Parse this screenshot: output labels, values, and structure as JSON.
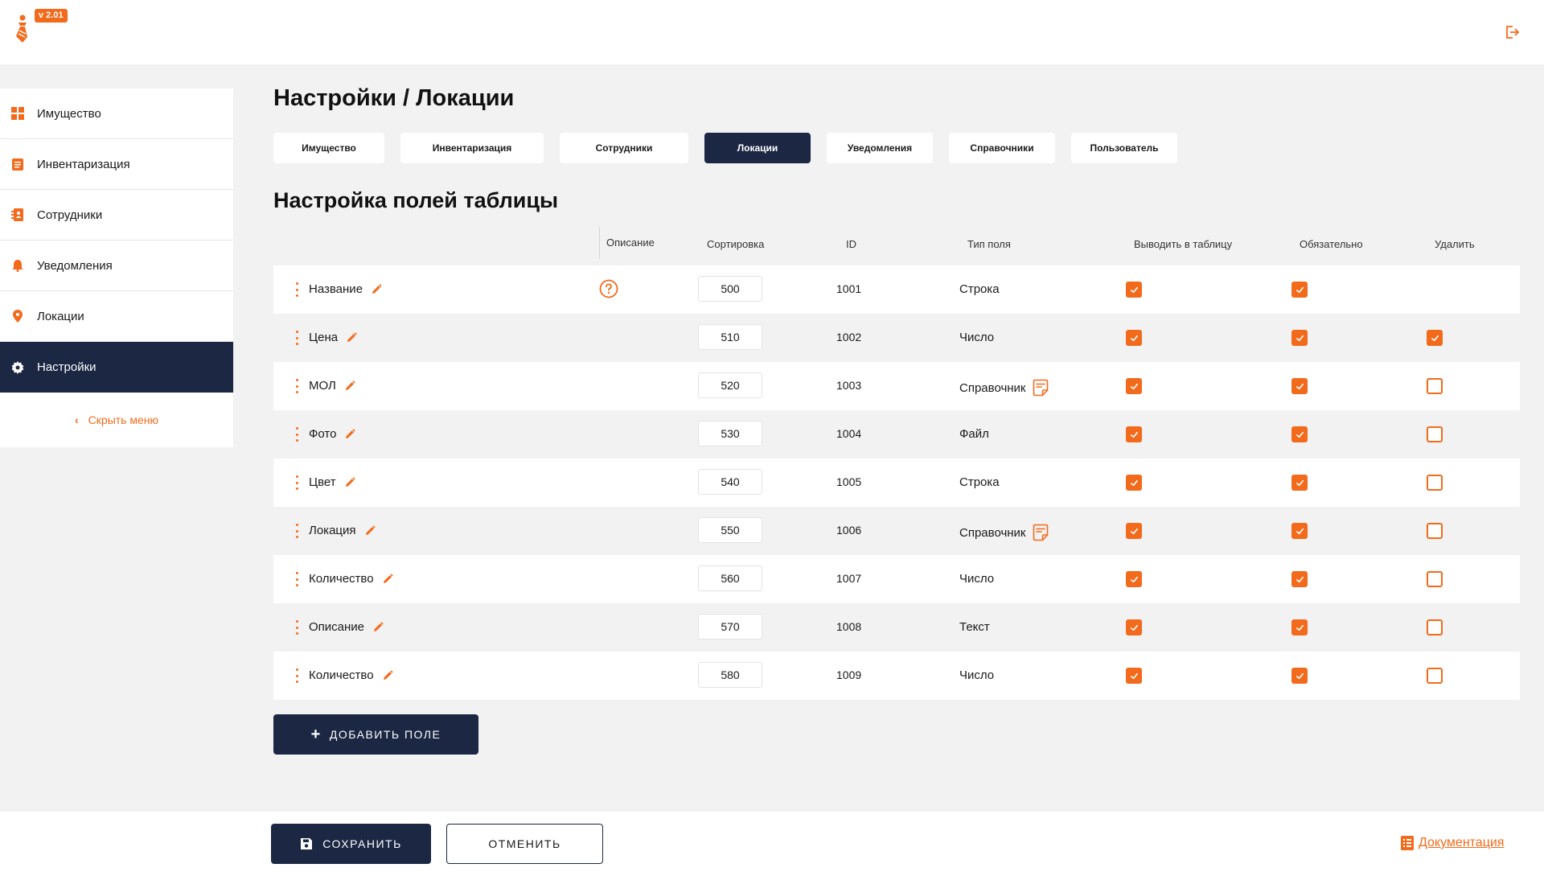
{
  "app": {
    "version": "v 2.01"
  },
  "sidebar": {
    "items": [
      {
        "label": "Имущество",
        "icon": "grid-icon"
      },
      {
        "label": "Инвентаризация",
        "icon": "clipboard-icon"
      },
      {
        "label": "Сотрудники",
        "icon": "contacts-book-icon"
      },
      {
        "label": "Уведомления",
        "icon": "bell-icon"
      },
      {
        "label": "Локации",
        "icon": "map-pin-icon"
      },
      {
        "label": "Настройки",
        "icon": "gear-icon",
        "active": true
      }
    ],
    "hide_label": "Скрыть меню"
  },
  "page": {
    "title": "Настройки / Локации"
  },
  "tabs": [
    {
      "label": "Имущество"
    },
    {
      "label": "Инвентаризация"
    },
    {
      "label": "Сотрудники"
    },
    {
      "label": "Локации",
      "active": true
    },
    {
      "label": "Уведомления"
    },
    {
      "label": "Справочники"
    },
    {
      "label": "Пользователь"
    }
  ],
  "section": {
    "title": "Настройка полей таблицы"
  },
  "table": {
    "headers": {
      "description": "Описание",
      "sort": "Сортировка",
      "id": "ID",
      "type": "Тип поля",
      "show": "Выводить в таблицу",
      "required": "Обязательно",
      "delete": "Удалить"
    },
    "rows": [
      {
        "name": "Название",
        "sort": "500",
        "id": "1001",
        "type": "Строка",
        "help": true,
        "show": true,
        "required": true,
        "delete": null
      },
      {
        "name": "Цена",
        "sort": "510",
        "id": "1002",
        "type": "Число",
        "show": true,
        "required": true,
        "delete": true
      },
      {
        "name": "МОЛ",
        "sort": "520",
        "id": "1003",
        "type": "Справочник",
        "dict": true,
        "show": true,
        "required": true,
        "delete": false
      },
      {
        "name": "Фото",
        "sort": "530",
        "id": "1004",
        "type": "Файл",
        "show": true,
        "required": true,
        "delete": false
      },
      {
        "name": "Цвет",
        "sort": "540",
        "id": "1005",
        "type": "Строка",
        "show": true,
        "required": true,
        "delete": false
      },
      {
        "name": "Локация",
        "sort": "550",
        "id": "1006",
        "type": "Справочник",
        "dict": true,
        "show": true,
        "required": true,
        "delete": false
      },
      {
        "name": "Количество",
        "sort": "560",
        "id": "1007",
        "type": "Число",
        "show": true,
        "required": true,
        "delete": false
      },
      {
        "name": "Описание",
        "sort": "570",
        "id": "1008",
        "type": "Текст",
        "show": true,
        "required": true,
        "delete": false
      },
      {
        "name": "Количество",
        "sort": "580",
        "id": "1009",
        "type": "Число",
        "show": true,
        "required": true,
        "delete": false
      }
    ]
  },
  "actions": {
    "add_field": "ДОБАВИТЬ ПОЛЕ",
    "save": "СОХРАНИТЬ",
    "cancel": "ОТМЕНИТЬ",
    "docs": "Документация"
  },
  "colors": {
    "accent": "#f26b1d",
    "dark": "#1b2743",
    "background": "#f2f2f2"
  }
}
